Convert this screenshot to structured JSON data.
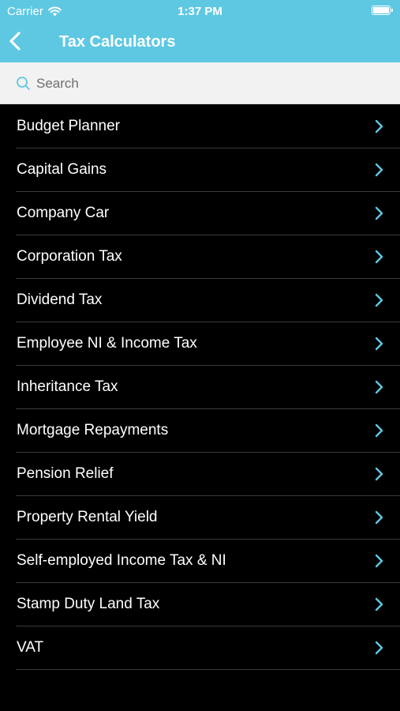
{
  "status_bar": {
    "carrier": "Carrier",
    "time": "1:37 PM"
  },
  "nav": {
    "title": "Tax Calculators"
  },
  "search": {
    "placeholder": "Search"
  },
  "colors": {
    "header": "#5ec8e3",
    "chevron": "#5ec8e3",
    "list_bg": "#000000",
    "text": "#ffffff"
  },
  "calculators": [
    {
      "label": "Budget Planner"
    },
    {
      "label": "Capital Gains"
    },
    {
      "label": "Company Car"
    },
    {
      "label": "Corporation Tax"
    },
    {
      "label": "Dividend Tax"
    },
    {
      "label": "Employee NI & Income Tax"
    },
    {
      "label": "Inheritance Tax"
    },
    {
      "label": "Mortgage Repayments"
    },
    {
      "label": "Pension Relief"
    },
    {
      "label": "Property Rental Yield"
    },
    {
      "label": "Self-employed Income Tax & NI"
    },
    {
      "label": "Stamp Duty Land Tax"
    },
    {
      "label": "VAT"
    }
  ]
}
